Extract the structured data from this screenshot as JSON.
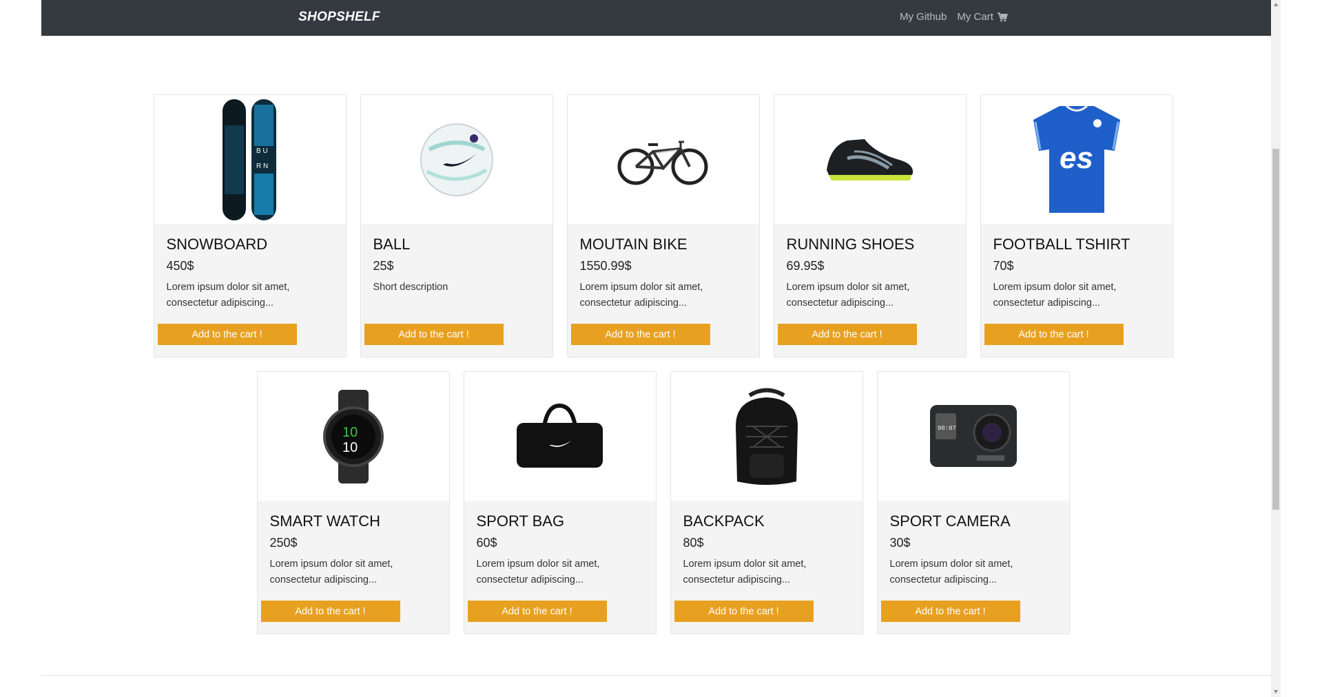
{
  "navbar": {
    "brand": "SHOPSHELF",
    "github_label": "My Github",
    "cart_label": "My Cart",
    "cart_icon": "shopping-cart-icon"
  },
  "products": [
    {
      "name": "SNOWBOARD",
      "price": "450$",
      "description": "Lorem ipsum dolor sit amet, consectetur adipiscing...",
      "button": "Add to the cart !",
      "image": "snowboard-image"
    },
    {
      "name": "BALL",
      "price": "25$",
      "description": "Short description",
      "button": "Add to the cart !",
      "image": "ball-image"
    },
    {
      "name": "MOUTAIN BIKE",
      "price": "1550.99$",
      "description": "Lorem ipsum dolor sit amet, consectetur adipiscing...",
      "button": "Add to the cart !",
      "image": "bike-image"
    },
    {
      "name": "RUNNING SHOES",
      "price": "69.95$",
      "description": "Lorem ipsum dolor sit amet, consectetur adipiscing...",
      "button": "Add to the cart !",
      "image": "shoes-image"
    },
    {
      "name": "FOOTBALL TSHIRT",
      "price": "70$",
      "description": "Lorem ipsum dolor sit amet, consectetur adipiscing...",
      "button": "Add to the cart !",
      "image": "tshirt-image"
    },
    {
      "name": "SMART WATCH",
      "price": "250$",
      "description": "Lorem ipsum dolor sit amet, consectetur adipiscing...",
      "button": "Add to the cart !",
      "image": "watch-image"
    },
    {
      "name": "SPORT BAG",
      "price": "60$",
      "description": "Lorem ipsum dolor sit amet, consectetur adipiscing...",
      "button": "Add to the cart !",
      "image": "bag-image"
    },
    {
      "name": "BACKPACK",
      "price": "80$",
      "description": "Lorem ipsum dolor sit amet, consectetur adipiscing...",
      "button": "Add to the cart !",
      "image": "backpack-image"
    },
    {
      "name": "SPORT CAMERA",
      "price": "30$",
      "description": "Lorem ipsum dolor sit amet, consectetur adipiscing...",
      "button": "Add to the cart !",
      "image": "camera-image"
    }
  ],
  "colors": {
    "navbar": "#343a40",
    "accent_button": "#e8a020",
    "card_bg": "#f4f4f4"
  }
}
